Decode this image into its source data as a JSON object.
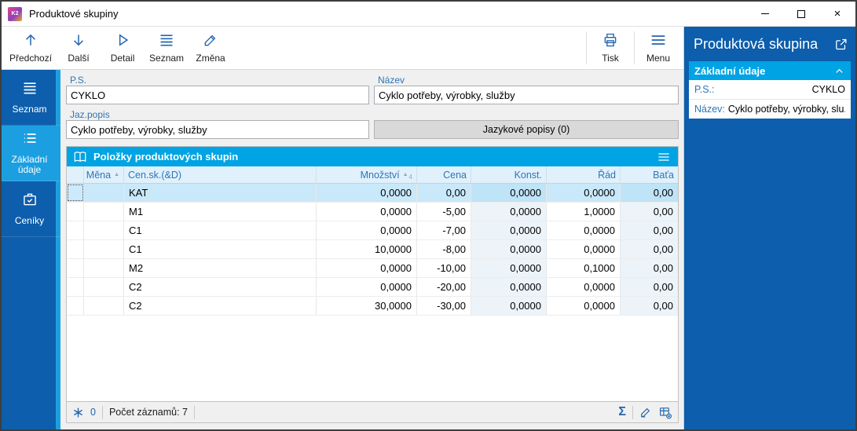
{
  "window": {
    "title": "Produktové skupiny",
    "app_icon_text": "K2"
  },
  "toolbar": {
    "predchozi": "Předchozí",
    "dalsi": "Další",
    "detail": "Detail",
    "seznam": "Seznam",
    "zmena": "Změna",
    "tisk": "Tisk",
    "menu": "Menu"
  },
  "sidebar": {
    "items": [
      {
        "label": "Seznam",
        "icon": "menu-lines"
      },
      {
        "label": "Základní údaje",
        "icon": "dotted-list"
      },
      {
        "label": "Ceníky",
        "icon": "briefcase-check"
      }
    ]
  },
  "form": {
    "ps": {
      "label": "P.S.",
      "value": "CYKLO"
    },
    "nazev": {
      "label": "Název",
      "value": "Cyklo potřeby, výrobky, služby"
    },
    "jaz_popis": {
      "label": "Jaz.popis",
      "value": "Cyklo potřeby, výrobky, služby"
    },
    "jazykove_popisy_button": "Jazykové popisy (0)"
  },
  "grid": {
    "title": "Položky produktových skupin",
    "columns": [
      "Měna",
      "Cen.sk.(&D)",
      "Množství",
      "Cena",
      "Konst.",
      "Řád",
      "Baťa"
    ],
    "sort": {
      "asc_icon": "▲",
      "mnozstvi_priority": "4"
    },
    "rows": [
      {
        "mena": "",
        "censk": "KAT",
        "mnozstvi": "0,0000",
        "cena": "0,00",
        "konst": "0,0000",
        "rad": "0,0000",
        "bata": "0,00"
      },
      {
        "mena": "",
        "censk": "M1",
        "mnozstvi": "0,0000",
        "cena": "-5,00",
        "konst": "0,0000",
        "rad": "1,0000",
        "bata": "0,00"
      },
      {
        "mena": "",
        "censk": "C1",
        "mnozstvi": "0,0000",
        "cena": "-7,00",
        "konst": "0,0000",
        "rad": "0,0000",
        "bata": "0,00"
      },
      {
        "mena": "",
        "censk": "C1",
        "mnozstvi": "10,0000",
        "cena": "-8,00",
        "konst": "0,0000",
        "rad": "0,0000",
        "bata": "0,00"
      },
      {
        "mena": "",
        "censk": "M2",
        "mnozstvi": "0,0000",
        "cena": "-10,00",
        "konst": "0,0000",
        "rad": "0,1000",
        "bata": "0,00"
      },
      {
        "mena": "",
        "censk": "C2",
        "mnozstvi": "0,0000",
        "cena": "-20,00",
        "konst": "0,0000",
        "rad": "0,0000",
        "bata": "0,00"
      },
      {
        "mena": "",
        "censk": "C2",
        "mnozstvi": "30,0000",
        "cena": "-30,00",
        "konst": "0,0000",
        "rad": "0,0000",
        "bata": "0,00"
      }
    ],
    "footer": {
      "flag_count": "0",
      "record_count": "Počet záznamů: 7"
    }
  },
  "right_panel": {
    "title": "Produktová skupina",
    "section_title": "Základní údaje",
    "rows": [
      {
        "label": "P.S.:",
        "value": "CYKLO"
      },
      {
        "label": "Název:",
        "value": "Cyklo potřeby, výrobky, slu..."
      }
    ]
  },
  "colors": {
    "dark_blue": "#0d5eac",
    "accent_cyan": "#00a3e3",
    "sidebar_active": "#1c9fe0",
    "toolbar_icon_blue": "#2264ae",
    "header_text_blue": "#2e75b6",
    "selected_row": "#c9e8fa"
  }
}
